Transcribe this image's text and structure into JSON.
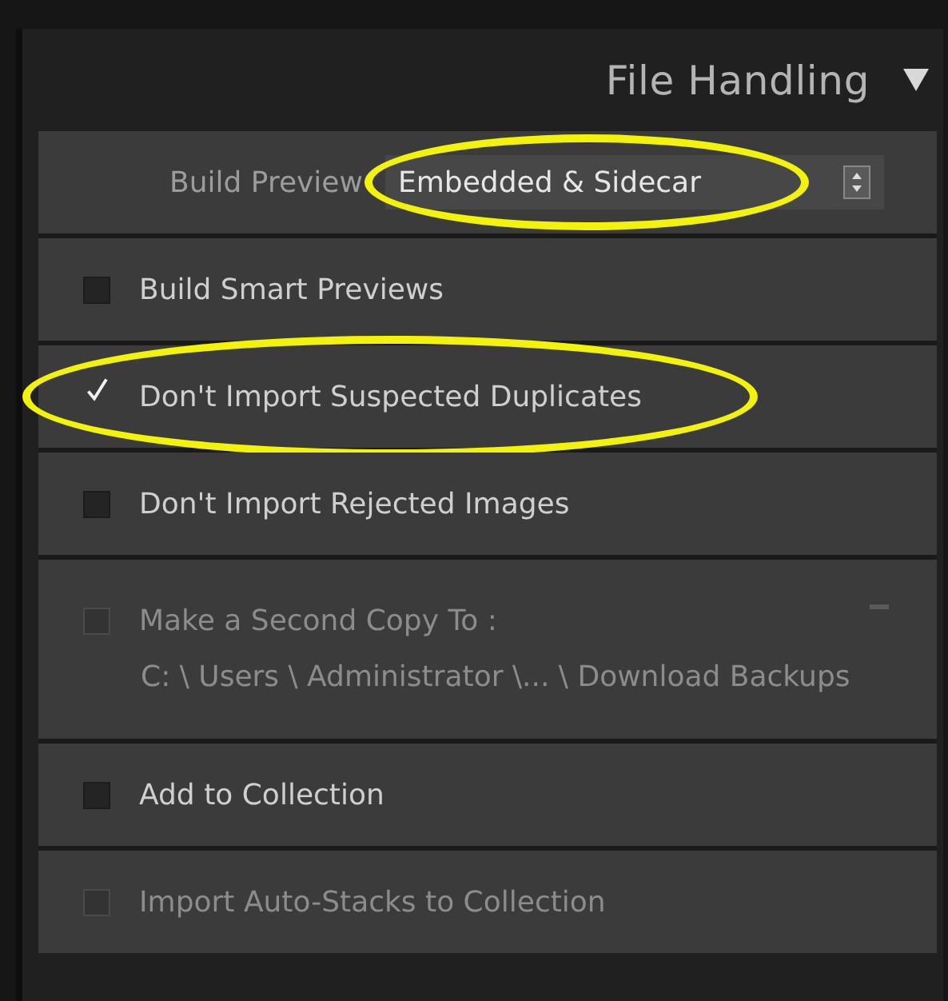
{
  "panel": {
    "title": "File Handling",
    "expanded": true
  },
  "build_previews": {
    "label": "Build Preview",
    "value": "Embedded & Sidecar",
    "highlighted": true
  },
  "options": [
    {
      "kind": "checkbox",
      "label": "Build Smart Previews",
      "checked": false,
      "disabled": false,
      "highlighted": false
    },
    {
      "kind": "checkbox",
      "label": "Don't Import Suspected Duplicates",
      "checked": true,
      "disabled": false,
      "highlighted": true
    },
    {
      "kind": "checkbox",
      "label": "Don't Import Rejected Images",
      "checked": false,
      "disabled": false,
      "highlighted": false
    },
    {
      "kind": "copy",
      "label": "Make a Second Copy To :",
      "path": "C: \\ Users \\ Administrator \\... \\ Download Backups",
      "checked": false,
      "disabled": true,
      "highlighted": false
    },
    {
      "kind": "checkbox",
      "label": "Add to Collection",
      "checked": false,
      "disabled": false,
      "highlighted": false
    },
    {
      "kind": "checkbox",
      "label": "Import Auto-Stacks to Collection",
      "checked": false,
      "disabled": true,
      "highlighted": false
    }
  ]
}
